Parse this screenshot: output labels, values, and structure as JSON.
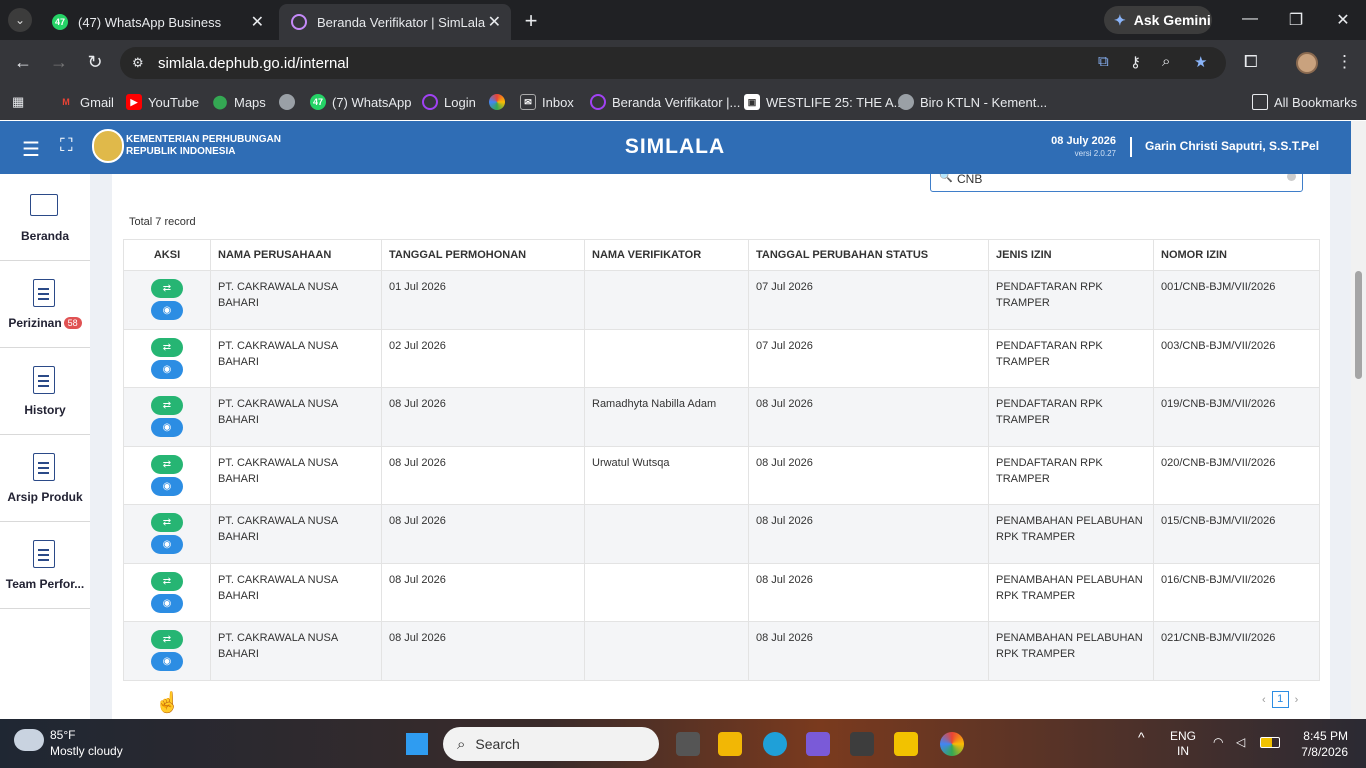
{
  "browser": {
    "tabs": [
      {
        "label": "(47) WhatsApp Business",
        "favicon": "whatsapp-icon",
        "badge": "47"
      },
      {
        "label": "Beranda Verifikator | SimLala",
        "favicon": "simlala-icon"
      }
    ],
    "ask_gemini": "Ask Gemini",
    "url": "simlala.dephub.go.id/internal",
    "bookmarks": [
      {
        "label": "Gmail",
        "icon": "gmail-icon",
        "color": "#ea4335"
      },
      {
        "label": "YouTube",
        "icon": "youtube-icon",
        "color": "#ff0000"
      },
      {
        "label": "Maps",
        "icon": "maps-icon",
        "color": "#34a853"
      },
      {
        "label": "",
        "icon": "globe-icon",
        "color": "#9aa0a6"
      },
      {
        "label": "(7) WhatsApp",
        "icon": "whatsapp-icon",
        "color": "#25d366"
      },
      {
        "label": "Login",
        "icon": "login-icon",
        "color": "#a142f4"
      },
      {
        "label": "",
        "icon": "pinwheel-icon",
        "color": "#fbbc04"
      },
      {
        "label": "Inbox",
        "icon": "inbox-icon",
        "color": "#555"
      },
      {
        "label": "Beranda Verifikator |...",
        "icon": "simlala-icon",
        "color": "#a142f4"
      },
      {
        "label": "WESTLIFE 25: THE A...",
        "icon": "document-icon",
        "color": "#fff"
      },
      {
        "label": "Biro KTLN - Kement...",
        "icon": "globe-icon",
        "color": "#9aa0a6"
      }
    ],
    "all_bookmarks": "All Bookmarks"
  },
  "app": {
    "ministry_line1": "KEMENTERIAN PERHUBUNGAN",
    "ministry_line2": "REPUBLIK INDONESIA",
    "title": "SIMLALA",
    "date": "08 July 2026",
    "version": "versi 2.0.27",
    "user": "Garin Christi Saputri, S.S.T.Pel"
  },
  "sidebar": {
    "items": [
      {
        "label": "Beranda",
        "icon": "monitor-icon"
      },
      {
        "label": "Perizinan",
        "icon": "document-icon",
        "badge": "58"
      },
      {
        "label": "History",
        "icon": "document-icon"
      },
      {
        "label": "Arsip Produk",
        "icon": "document-icon"
      },
      {
        "label": "Team Perfor...",
        "icon": "document-icon"
      }
    ]
  },
  "search": {
    "value": "CNB"
  },
  "table": {
    "total": "Total 7 record",
    "columns": [
      "AKSI",
      "NAMA PERUSAHAAN",
      "TANGGAL PERMOHONAN",
      "NAMA VERIFIKATOR",
      "TANGGAL PERUBAHAN STATUS",
      "JENIS IZIN",
      "NOMOR IZIN"
    ],
    "rows": [
      {
        "perusahaan": "PT. CAKRAWALA NUSA BAHARI",
        "tgl_permohonan": "01 Jul 2026",
        "verifikator": "",
        "tgl_status": "07 Jul 2026",
        "jenis": "PENDAFTARAN RPK TRAMPER",
        "nomor": "001/CNB-BJM/VII/2026"
      },
      {
        "perusahaan": "PT. CAKRAWALA NUSA BAHARI",
        "tgl_permohonan": "02 Jul 2026",
        "verifikator": "",
        "tgl_status": "07 Jul 2026",
        "jenis": "PENDAFTARAN RPK TRAMPER",
        "nomor": "003/CNB-BJM/VII/2026"
      },
      {
        "perusahaan": "PT. CAKRAWALA NUSA BAHARI",
        "tgl_permohonan": "08 Jul 2026",
        "verifikator": "Ramadhyta Nabilla Adam",
        "tgl_status": "08 Jul 2026",
        "jenis": "PENDAFTARAN RPK TRAMPER",
        "nomor": "019/CNB-BJM/VII/2026"
      },
      {
        "perusahaan": "PT. CAKRAWALA NUSA BAHARI",
        "tgl_permohonan": "08 Jul 2026",
        "verifikator": "Urwatul Wutsqa",
        "tgl_status": "08 Jul 2026",
        "jenis": "PENDAFTARAN RPK TRAMPER",
        "nomor": "020/CNB-BJM/VII/2026"
      },
      {
        "perusahaan": "PT. CAKRAWALA NUSA BAHARI",
        "tgl_permohonan": "08 Jul 2026",
        "verifikator": "",
        "tgl_status": "08 Jul 2026",
        "jenis": "PENAMBAHAN PELABUHAN RPK TRAMPER",
        "nomor": "015/CNB-BJM/VII/2026"
      },
      {
        "perusahaan": "PT. CAKRAWALA NUSA BAHARI",
        "tgl_permohonan": "08 Jul 2026",
        "verifikator": "",
        "tgl_status": "08 Jul 2026",
        "jenis": "PENAMBAHAN PELABUHAN RPK TRAMPER",
        "nomor": "016/CNB-BJM/VII/2026"
      },
      {
        "perusahaan": "PT. CAKRAWALA NUSA BAHARI",
        "tgl_permohonan": "08 Jul 2026",
        "verifikator": "",
        "tgl_status": "08 Jul 2026",
        "jenis": "PENAMBAHAN PELABUHAN RPK TRAMPER",
        "nomor": "021/CNB-BJM/VII/2026"
      }
    ]
  },
  "pagination": {
    "current": "1"
  },
  "taskbar": {
    "temp": "85°F",
    "weather": "Mostly cloudy",
    "search": "Search",
    "lang1": "ENG",
    "lang2": "IN",
    "time": "8:45 PM",
    "date": "7/8/2026"
  },
  "colors": {
    "header": "#2f6db5",
    "accent_green": "#26b573",
    "accent_blue": "#2c8de3",
    "badge": "#e05253"
  }
}
